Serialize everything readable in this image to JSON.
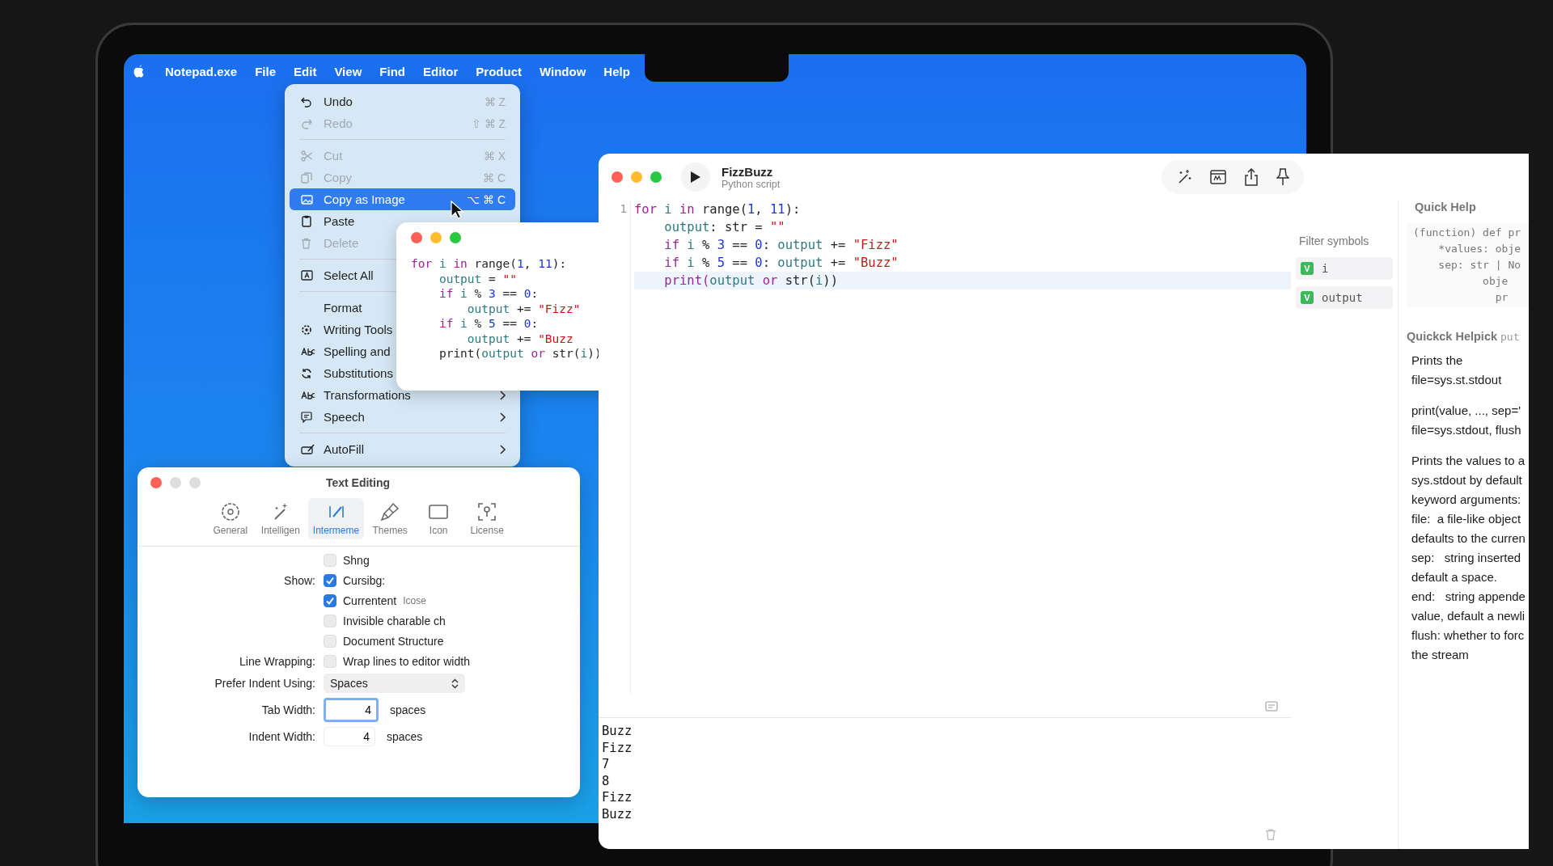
{
  "menu_bar": {
    "app_name": "Notepad.exe",
    "items": [
      "File",
      "Edit",
      "View",
      "Find",
      "Editor",
      "Product",
      "Window",
      "Help"
    ]
  },
  "edit_menu": {
    "items": [
      {
        "kind": "item",
        "label": "Undo",
        "shortcut": "⌘ Z",
        "disabled": false,
        "selected": false,
        "submenu": false
      },
      {
        "kind": "item",
        "label": "Redo",
        "shortcut": "⇧ ⌘ Z",
        "disabled": true,
        "selected": false,
        "submenu": false
      },
      {
        "kind": "separator"
      },
      {
        "kind": "item",
        "label": "Cut",
        "shortcut": "⌘ X",
        "disabled": true,
        "selected": false,
        "submenu": false
      },
      {
        "kind": "item",
        "label": "Copy",
        "shortcut": "⌘ C",
        "disabled": true,
        "selected": false,
        "submenu": false
      },
      {
        "kind": "item",
        "label": "Copy as Image",
        "shortcut": "⌥ ⌘ C",
        "disabled": false,
        "selected": true,
        "submenu": false
      },
      {
        "kind": "item",
        "label": "Paste",
        "disabled": false,
        "selected": false,
        "submenu": false
      },
      {
        "kind": "item",
        "label": "Delete",
        "disabled": true,
        "selected": false,
        "submenu": false
      },
      {
        "kind": "separator"
      },
      {
        "kind": "item",
        "label": "Select All",
        "disabled": false,
        "selected": false
      },
      {
        "kind": "separator"
      },
      {
        "kind": "item",
        "label": "Format",
        "disabled": false,
        "selected": false
      },
      {
        "kind": "item",
        "label": "Writing Tools",
        "disabled": false,
        "selected": false
      },
      {
        "kind": "item",
        "label": "Spelling and",
        "disabled": false,
        "selected": false
      },
      {
        "kind": "item",
        "label": "Substitutions",
        "disabled": false,
        "selected": false
      },
      {
        "kind": "item",
        "label": "Transformations",
        "disabled": false,
        "selected": false,
        "submenu": true
      },
      {
        "kind": "item",
        "label": "Speech",
        "disabled": false,
        "selected": false,
        "submenu": true
      },
      {
        "kind": "separator"
      },
      {
        "kind": "item",
        "label": "AutoFill",
        "disabled": false,
        "selected": false,
        "submenu": true
      }
    ]
  },
  "snippet_window": {
    "code": [
      [
        {
          "kind": "keyword",
          "t": "for "
        },
        {
          "kind": "name",
          "t": "i "
        },
        {
          "kind": "keyword",
          "t": "in "
        },
        {
          "kind": "plain",
          "t": "range("
        },
        {
          "kind": "number",
          "t": "1"
        },
        {
          "kind": "plain",
          "t": ", "
        },
        {
          "kind": "number",
          "t": "11"
        },
        {
          "kind": "plain",
          "t": "):"
        }
      ],
      [
        {
          "kind": "name",
          "t": "    output"
        },
        {
          "kind": "plain",
          "t": " = "
        },
        {
          "kind": "string",
          "t": "\"\""
        }
      ],
      [
        {
          "kind": "keyword",
          "t": "    if "
        },
        {
          "kind": "name",
          "t": "i "
        },
        {
          "kind": "plain",
          "t": "% "
        },
        {
          "kind": "number",
          "t": "3"
        },
        {
          "kind": "plain",
          "t": " == "
        },
        {
          "kind": "number",
          "t": "0"
        },
        {
          "kind": "plain",
          "t": ":"
        }
      ],
      [
        {
          "kind": "name",
          "t": "        output"
        },
        {
          "kind": "plain",
          "t": " += "
        },
        {
          "kind": "string",
          "t": "\"Fizz\""
        }
      ],
      [
        {
          "kind": "keyword",
          "t": "    if "
        },
        {
          "kind": "name",
          "t": "i "
        },
        {
          "kind": "plain",
          "t": "% "
        },
        {
          "kind": "number",
          "t": "5"
        },
        {
          "kind": "plain",
          "t": " == "
        },
        {
          "kind": "number",
          "t": "0"
        },
        {
          "kind": "plain",
          "t": ":"
        }
      ],
      [
        {
          "kind": "name",
          "t": "        output"
        },
        {
          "kind": "plain",
          "t": " += "
        },
        {
          "kind": "string",
          "t": "\"Buzz"
        }
      ],
      [
        {
          "kind": "plain",
          "t": "    print("
        },
        {
          "kind": "name",
          "t": "output "
        },
        {
          "kind": "keyword",
          "t": "or "
        },
        {
          "kind": "plain",
          "t": "str("
        },
        {
          "kind": "name",
          "t": "i"
        },
        {
          "kind": "plain",
          "t": "))"
        }
      ]
    ]
  },
  "editor_window": {
    "title": "FizzBuzz",
    "subtitle": "Python script",
    "line_number": "1",
    "code": [
      {
        "current": false,
        "tokens": [
          {
            "kind": "keyword",
            "t": "for "
          },
          {
            "kind": "name",
            "t": "i "
          },
          {
            "kind": "keyword",
            "t": "in "
          },
          {
            "kind": "plain",
            "t": "range("
          },
          {
            "kind": "number",
            "t": "1"
          },
          {
            "kind": "plain",
            "t": ", "
          },
          {
            "kind": "number",
            "t": "11"
          },
          {
            "kind": "plain",
            "t": "):"
          }
        ]
      },
      {
        "current": false,
        "tokens": [
          {
            "kind": "name",
            "t": "    output"
          },
          {
            "kind": "plain",
            "t": ": str = "
          },
          {
            "kind": "string",
            "t": "\"\""
          }
        ]
      },
      {
        "current": false,
        "tokens": [
          {
            "kind": "keyword",
            "t": "    if "
          },
          {
            "kind": "name",
            "t": "i "
          },
          {
            "kind": "plain",
            "t": "% "
          },
          {
            "kind": "number",
            "t": "3"
          },
          {
            "kind": "plain",
            "t": " == "
          },
          {
            "kind": "number",
            "t": "0"
          },
          {
            "kind": "plain",
            "t": ": "
          },
          {
            "kind": "name",
            "t": "output"
          },
          {
            "kind": "plain",
            "t": " += "
          },
          {
            "kind": "string",
            "t": "\"Fizz\""
          }
        ]
      },
      {
        "current": false,
        "tokens": [
          {
            "kind": "keyword",
            "t": "    if "
          },
          {
            "kind": "name",
            "t": "i "
          },
          {
            "kind": "plain",
            "t": "% "
          },
          {
            "kind": "number",
            "t": "5"
          },
          {
            "kind": "plain",
            "t": " == "
          },
          {
            "kind": "number",
            "t": "0"
          },
          {
            "kind": "plain",
            "t": ": "
          },
          {
            "kind": "name",
            "t": "output"
          },
          {
            "kind": "plain",
            "t": " += "
          },
          {
            "kind": "string",
            "t": "\"Buzz\""
          }
        ]
      },
      {
        "current": true,
        "tokens": [
          {
            "kind": "keyword",
            "t": "    print("
          },
          {
            "kind": "name",
            "t": "output "
          },
          {
            "kind": "keyword",
            "t": "or "
          },
          {
            "kind": "plain",
            "t": "str("
          },
          {
            "kind": "name",
            "t": "i"
          },
          {
            "kind": "plain",
            "t": "))"
          }
        ]
      }
    ],
    "symbols": {
      "placeholder": "Filter symbols",
      "items": [
        {
          "badge": "V",
          "name": "i"
        },
        {
          "badge": "V",
          "name": "output"
        }
      ]
    },
    "quick_help": {
      "title": "Quick Help",
      "signature": [
        "(function) def pr",
        "    *values: obje",
        "    sep: str | No",
        "           obje",
        "             pr"
      ],
      "overlay_title": "Quickck Helpick",
      "overlay_note": "put",
      "paragraphs": [
        [
          "Prints the",
          "file=sys.st.stdout"
        ],
        [
          "print(value, ..., sep='",
          "file=sys.stdout, flush"
        ],
        [
          "Prints the values to a",
          "sys.stdout by default",
          "keyword arguments:",
          "file:  a file-like object",
          "defaults to the curren",
          "sep:   string inserted",
          "default a space.",
          "end:   string appende",
          "value, default a newli",
          "flush: whether to forc",
          "the stream"
        ]
      ]
    },
    "console": [
      "Buzz",
      "Fizz",
      "7",
      "8",
      "Fizz",
      "Buzz"
    ]
  },
  "settings_window": {
    "title": "Text Editing",
    "tabs": [
      {
        "label": "General",
        "selected": false
      },
      {
        "label": "Intelligen",
        "selected": false
      },
      {
        "label": "Intermeme",
        "selected": true
      },
      {
        "label": "Themes",
        "selected": false
      },
      {
        "label": "Icon",
        "selected": false
      },
      {
        "label": "License",
        "selected": false
      }
    ],
    "rows": [
      {
        "kind": "checkbox",
        "text": "Shng",
        "checked": false
      },
      {
        "kind": "checkbox",
        "label": "Show:",
        "text": "Cursibg:",
        "checked": true
      },
      {
        "kind": "checkbox",
        "text": "Currentent",
        "note": "Icose",
        "checked": true
      },
      {
        "kind": "checkbox",
        "text": "Invisible charable ch",
        "checked": false
      },
      {
        "kind": "checkbox",
        "text": "Document Structure",
        "checked": false
      },
      {
        "kind": "checkbox",
        "label": "Line Wrapping:",
        "text": "Wrap lines to editor width",
        "checked": false
      },
      {
        "kind": "select",
        "label": "Prefer Indent Using:",
        "value": "Spaces"
      },
      {
        "kind": "number",
        "label": "Tab Width:",
        "value": "4",
        "unit": "spaces",
        "focused": true
      },
      {
        "kind": "number",
        "label": "Indent Width:",
        "value": "4",
        "unit": "spaces",
        "focused": false
      }
    ]
  }
}
